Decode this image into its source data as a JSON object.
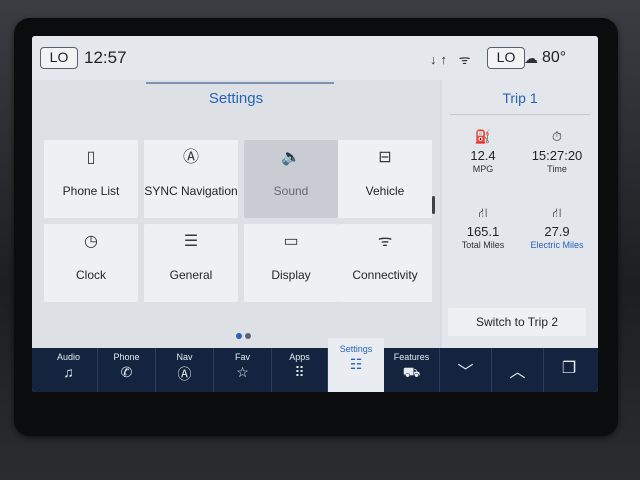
{
  "status": {
    "left_lo": "LO",
    "time": "12:57",
    "icons": "↓↑ ᯤ",
    "right_lo": "LO",
    "weather_icon": "☁",
    "temperature": "80°"
  },
  "main": {
    "title": "Settings",
    "tiles": [
      {
        "label": "Phone List",
        "icon": "▯"
      },
      {
        "label": "SYNC Navigation",
        "icon": "Ⓐ"
      },
      {
        "label": "Sound",
        "icon": "🔈"
      },
      {
        "label": "Vehicle",
        "icon": "⊟"
      },
      {
        "label": "Clock",
        "icon": "◷"
      },
      {
        "label": "General",
        "icon": "☰"
      },
      {
        "label": "Display",
        "icon": "▭"
      },
      {
        "label": "Connectivity",
        "icon": "ᯤ"
      }
    ],
    "page_dots": {
      "count": 2,
      "active_index": 0
    }
  },
  "trip": {
    "title": "Trip 1",
    "stats": [
      {
        "value": "12.4",
        "label": "MPG",
        "icon": "⛽"
      },
      {
        "value": "15:27:20",
        "label": "Time",
        "icon": "⏱"
      },
      {
        "value": "165.1",
        "label": "Total Miles",
        "icon": "⛙"
      },
      {
        "value": "27.9",
        "label": "Electric Miles",
        "icon": "⛙"
      }
    ],
    "switch_label": "Switch to Trip 2"
  },
  "nav": [
    {
      "label": "Audio",
      "icon": "♫"
    },
    {
      "label": "Phone",
      "icon": "✆"
    },
    {
      "label": "Nav",
      "icon": "Ⓐ"
    },
    {
      "label": "Fav",
      "icon": "☆"
    },
    {
      "label": "Apps",
      "icon": "⠿"
    },
    {
      "label": "Settings",
      "icon": "☷"
    },
    {
      "label": "Features",
      "icon": "⛟"
    },
    {
      "label": "",
      "icon": "﹀"
    },
    {
      "label": "",
      "icon": "︿"
    },
    {
      "label": "",
      "icon": "❐"
    }
  ],
  "colors": {
    "accent": "#2862b8",
    "navbar": "#14243f",
    "dot_active": "#2862b8",
    "dot_inactive": "#5b6470"
  }
}
